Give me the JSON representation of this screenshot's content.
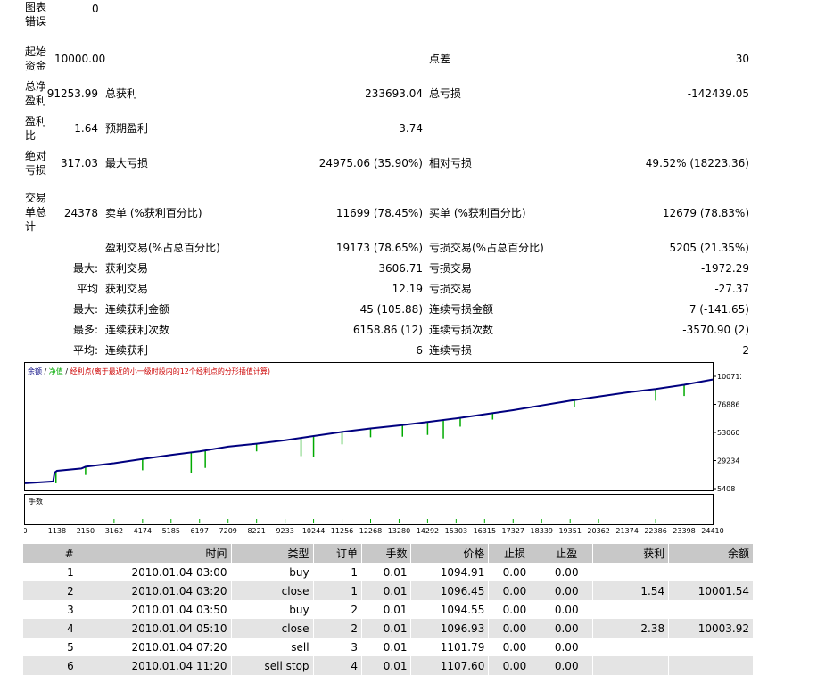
{
  "summary": {
    "chart_errors": {
      "label": "图表错误",
      "value": "0"
    },
    "initial_deposit": {
      "label": "起始资金",
      "value": "10000.00"
    },
    "spread": {
      "label": "点差",
      "value": "30"
    },
    "net_profit": {
      "label": "总净盈利",
      "value": "91253.99"
    },
    "gross_profit": {
      "label": "总获利",
      "value": "233693.04"
    },
    "gross_loss": {
      "label": "总亏损",
      "value": "-142439.05"
    },
    "profit_factor": {
      "label": "盈利比",
      "value": "1.64"
    },
    "expected_payoff": {
      "label": "预期盈利",
      "value": "3.74"
    },
    "absolute_drawdown": {
      "label": "绝对亏损",
      "value": "317.03"
    },
    "maximal_drawdown": {
      "label": "最大亏损",
      "value": "24975.06 (35.90%)"
    },
    "relative_drawdown": {
      "label": "相对亏损",
      "value": "49.52% (18223.36)"
    },
    "total_trades": {
      "label": "交易单总计",
      "value": "24378"
    },
    "short_positions": {
      "label": "卖单 (%获利百分比)",
      "value": "11699 (78.45%)"
    },
    "long_positions": {
      "label": "买单 (%获利百分比)",
      "value": "12679 (78.83%)"
    },
    "profit_trades": {
      "label": "盈利交易(%占总百分比)",
      "value": "19173 (78.65%)"
    },
    "loss_trades": {
      "label": "亏损交易(%占总百分比)",
      "value": "5205 (21.35%)"
    },
    "largest": {
      "prefix": "最大:",
      "profit_label": "获利交易",
      "profit_value": "3606.71",
      "loss_label": "亏损交易",
      "loss_value": "-1972.29"
    },
    "average": {
      "prefix": "平均",
      "profit_label": "获利交易",
      "profit_value": "12.19",
      "loss_label": "亏损交易",
      "loss_value": "-27.37"
    },
    "max_consec_amount": {
      "prefix": "最大:",
      "profit_label": "连续获利金额",
      "profit_value": "45 (105.88)",
      "loss_label": "连续亏损金额",
      "loss_value": "7 (-141.65)"
    },
    "max_consec_count": {
      "prefix": "最多:",
      "profit_label": "连续获利次数",
      "profit_value": "6158.86 (12)",
      "loss_label": "连续亏损次数",
      "loss_value": "-3570.90 (2)"
    },
    "avg_consec": {
      "prefix": "平均:",
      "profit_label": "连续获利",
      "profit_value": "6",
      "loss_label": "连续亏损",
      "loss_value": "2"
    }
  },
  "chart_data": {
    "type": "line",
    "legend": {
      "balance": "余额",
      "equity": "净值",
      "points": "经利点(离于最近的小一级时段内的12个经利点的分形插值计算)",
      "sep": "/"
    },
    "volume_label": "手数",
    "x_ticks": [
      "0",
      "1138",
      "2150",
      "3162",
      "4174",
      "5185",
      "6197",
      "7209",
      "8221",
      "9233",
      "10244",
      "11256",
      "12268",
      "13280",
      "14292",
      "15303",
      "16315",
      "17327",
      "18339",
      "19351",
      "20362",
      "21374",
      "22386",
      "23398",
      "24410"
    ],
    "y_ticks": [
      "100712",
      "76886",
      "53060",
      "29234",
      "5408"
    ],
    "ylim": [
      5408,
      100712
    ],
    "xlim": [
      0,
      24410
    ],
    "series": [
      {
        "name": "余额",
        "color": "#00007f",
        "x": [
          0,
          1000,
          1050,
          1138,
          2000,
          2150,
          3162,
          4174,
          5185,
          6197,
          7209,
          8221,
          9233,
          10244,
          11256,
          12268,
          13280,
          14292,
          15303,
          16315,
          17327,
          18339,
          19351,
          20362,
          21374,
          22386,
          23398,
          24410
        ],
        "y": [
          10000,
          11500,
          19000,
          20500,
          22500,
          24000,
          27000,
          30500,
          34000,
          37000,
          41000,
          43500,
          46500,
          50000,
          53500,
          56500,
          59000,
          62000,
          65000,
          68500,
          72000,
          76000,
          80000,
          83500,
          87000,
          90000,
          93500,
          98000
        ]
      },
      {
        "name": "净值",
        "color": "#00aa00",
        "dips": [
          [
            1100,
            10000
          ],
          [
            2150,
            17000
          ],
          [
            4174,
            21000
          ],
          [
            5900,
            19000
          ],
          [
            6400,
            23000
          ],
          [
            8221,
            37000
          ],
          [
            9800,
            33000
          ],
          [
            10244,
            32000
          ],
          [
            11256,
            43000
          ],
          [
            12268,
            49000
          ],
          [
            13400,
            49500
          ],
          [
            14292,
            51000
          ],
          [
            14850,
            48000
          ],
          [
            15450,
            58000
          ],
          [
            16600,
            64000
          ],
          [
            19500,
            74500
          ],
          [
            22386,
            80000
          ],
          [
            23398,
            84000
          ]
        ]
      }
    ],
    "volume_spikes": [
      3162,
      4174,
      5185,
      6197,
      7209,
      8221,
      9233,
      10244,
      11256,
      12268,
      13280,
      14292,
      15303,
      16315,
      17327,
      18339,
      19351,
      20362,
      22386
    ]
  },
  "trades": {
    "headers": [
      "#",
      "时间",
      "类型",
      "订单",
      "手数",
      "价格",
      "止损",
      "止盈",
      "获利",
      "余额"
    ],
    "rows": [
      [
        "1",
        "2010.01.04 03:00",
        "buy",
        "1",
        "0.01",
        "1094.91",
        "0.00",
        "0.00",
        "",
        ""
      ],
      [
        "2",
        "2010.01.04 03:20",
        "close",
        "1",
        "0.01",
        "1096.45",
        "0.00",
        "0.00",
        "1.54",
        "10001.54"
      ],
      [
        "3",
        "2010.01.04 03:50",
        "buy",
        "2",
        "0.01",
        "1094.55",
        "0.00",
        "0.00",
        "",
        ""
      ],
      [
        "4",
        "2010.01.04 05:10",
        "close",
        "2",
        "0.01",
        "1096.93",
        "0.00",
        "0.00",
        "2.38",
        "10003.92"
      ],
      [
        "5",
        "2010.01.04 07:20",
        "sell",
        "3",
        "0.01",
        "1101.79",
        "0.00",
        "0.00",
        "",
        ""
      ],
      [
        "6",
        "2010.01.04 11:20",
        "sell stop",
        "4",
        "0.01",
        "1107.60",
        "0.00",
        "0.00",
        "",
        ""
      ]
    ]
  }
}
